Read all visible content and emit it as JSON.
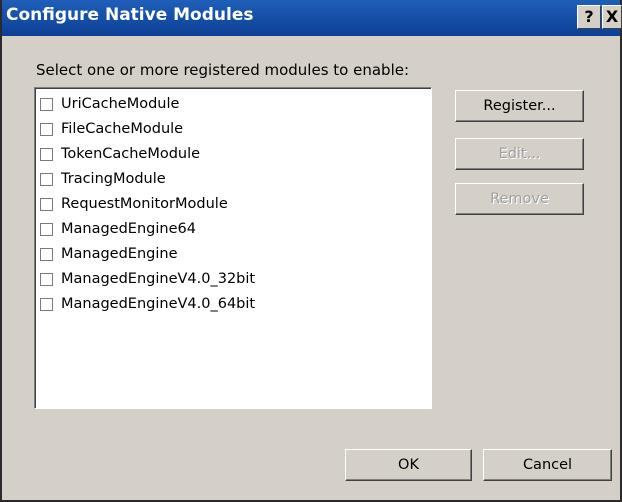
{
  "window": {
    "title": "Configure Native Modules",
    "help_label": "?",
    "close_label": "X"
  },
  "prompt": "Select one or more registered modules to enable:",
  "modules": [
    {
      "label": "UriCacheModule",
      "checked": false
    },
    {
      "label": "FileCacheModule",
      "checked": false
    },
    {
      "label": "TokenCacheModule",
      "checked": false
    },
    {
      "label": "TracingModule",
      "checked": false
    },
    {
      "label": "RequestMonitorModule",
      "checked": false
    },
    {
      "label": "ManagedEngine64",
      "checked": false
    },
    {
      "label": "ManagedEngine",
      "checked": false
    },
    {
      "label": "ManagedEngineV4.0_32bit",
      "checked": false
    },
    {
      "label": "ManagedEngineV4.0_64bit",
      "checked": false
    }
  ],
  "buttons": {
    "register": {
      "label": "Register...",
      "enabled": true
    },
    "edit": {
      "label": "Edit...",
      "enabled": false
    },
    "remove": {
      "label": "Remove",
      "enabled": false
    },
    "ok": {
      "label": "OK",
      "enabled": true
    },
    "cancel": {
      "label": "Cancel",
      "enabled": true
    }
  }
}
